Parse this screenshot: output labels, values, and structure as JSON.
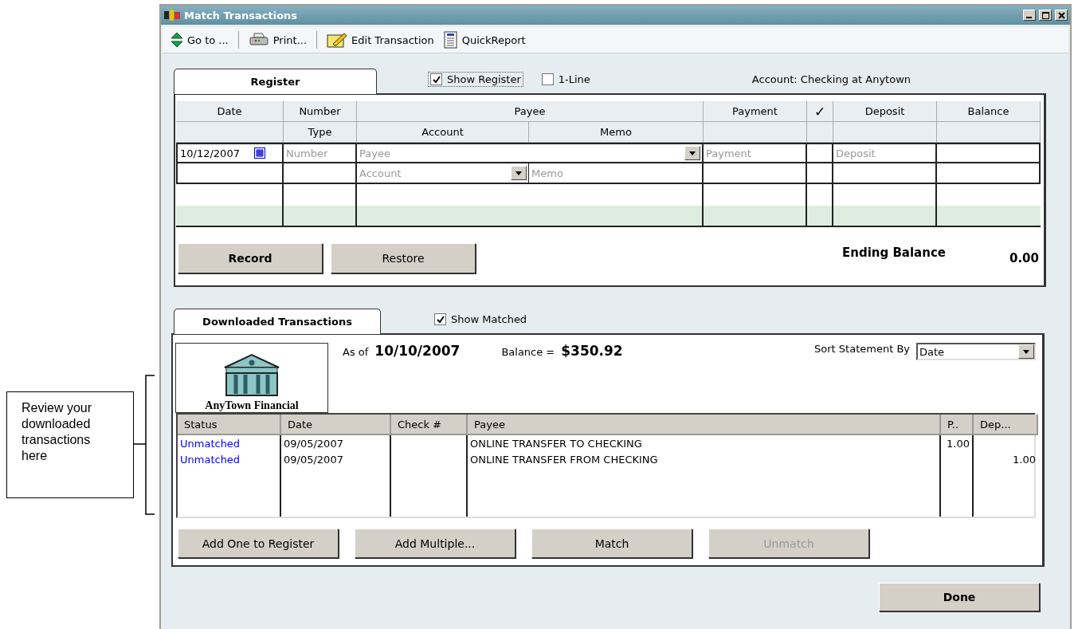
{
  "callout": {
    "text": "Review your downloaded transactions here"
  },
  "window": {
    "title": "Match Transactions",
    "controls": [
      {
        "kind": "minimize"
      },
      {
        "kind": "maximize"
      },
      {
        "kind": "close"
      }
    ]
  },
  "toolbar": [
    {
      "label": "Go to ...",
      "kind": "goto"
    },
    {
      "label": "Print...",
      "kind": "print"
    },
    {
      "label": "Edit Transaction",
      "kind": "edit"
    },
    {
      "label": "QuickReport",
      "kind": "report"
    }
  ],
  "register_section": {
    "tab": {
      "label": "Register",
      "selected": true
    },
    "options": [
      {
        "label": "Show Register",
        "checked": true,
        "focused": true
      },
      {
        "label": "1-Line",
        "checked": false,
        "focused": false
      }
    ],
    "account": "Account: Checking at Anytown",
    "header_row_1": [
      "Date",
      "Number",
      "Payee",
      "Payment",
      "✓",
      "Deposit",
      "Balance"
    ],
    "header_row_2": [
      "Type",
      "Account",
      "Memo"
    ],
    "entry": {
      "date": "10/12/2007",
      "number_placeholder": "Number",
      "payee_placeholder": "Payee",
      "payment_placeholder": "Payment",
      "deposit_placeholder": "Deposit",
      "account_placeholder": "Account",
      "memo_placeholder": "Memo"
    },
    "buttons": [
      {
        "label": "Record",
        "primary": true
      },
      {
        "label": "Restore",
        "primary": false
      }
    ],
    "ending_balance": {
      "label": "Ending Balance",
      "value": "0.00"
    }
  },
  "downloaded_section": {
    "tab": {
      "label": "Downloaded Transactions",
      "selected": true
    },
    "show_matched": {
      "label": "Show Matched",
      "checked": true
    },
    "bank_name": "AnyTown Financial",
    "as_of": {
      "label": "As of",
      "value": "10/10/2007"
    },
    "balance": {
      "label": "Balance =",
      "value": "$350.92"
    },
    "sort": {
      "label": "Sort Statement By",
      "value": "Date"
    },
    "columns": [
      "Status",
      "Date",
      "Check #",
      "Payee",
      "P..",
      "Dep..."
    ],
    "rows": [
      {
        "status": "Unmatched",
        "color": "#0000ff",
        "date": "09/05/2007",
        "payee": "ONLINE TRANSFER TO CHECKING",
        "payment": "1.00"
      },
      {
        "status": "Unmatched",
        "color": "#0000ff",
        "date": "09/05/2007",
        "payee": "ONLINE TRANSFER FROM CHECKING",
        "deposit": "1.00"
      }
    ],
    "buttons": [
      {
        "label": "Add One to Register",
        "disabled": false
      },
      {
        "label": "Add Multiple...",
        "disabled": false
      },
      {
        "label": "Match",
        "disabled": false
      },
      {
        "label": "Unmatch",
        "disabled": true
      }
    ]
  },
  "done_button": {
    "label": "Done"
  }
}
